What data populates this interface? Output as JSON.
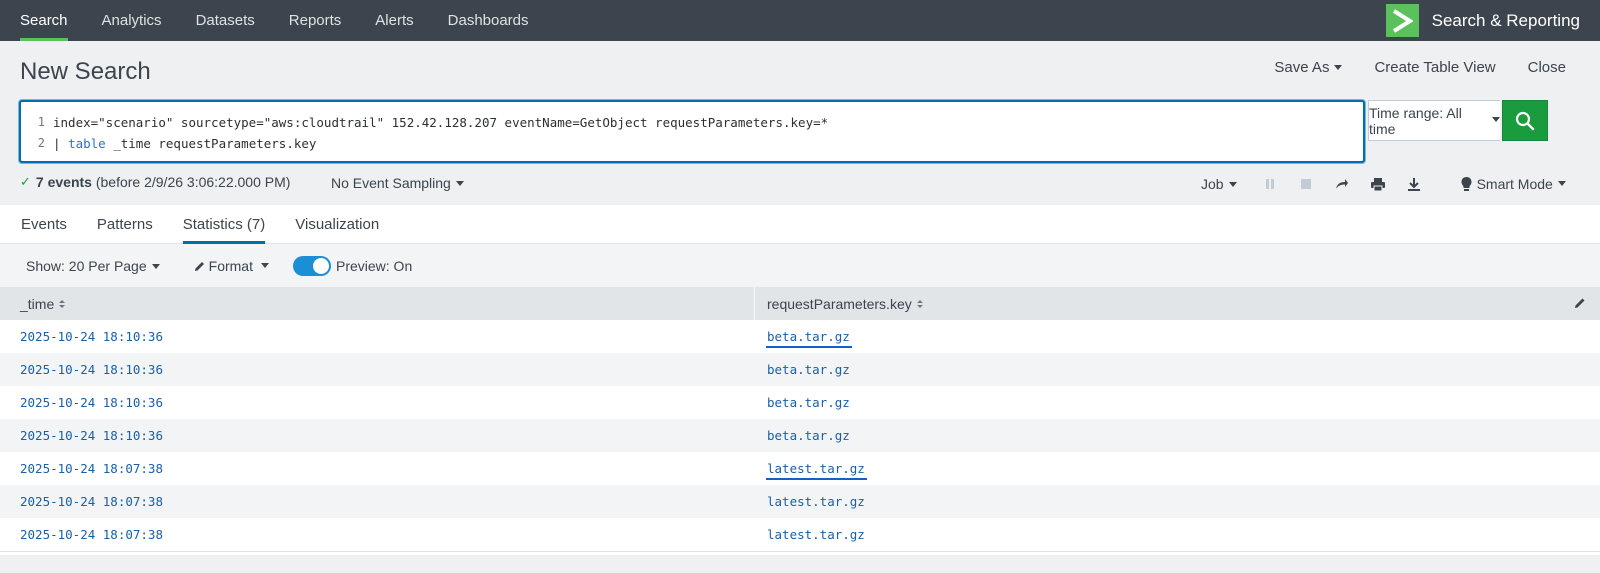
{
  "nav": {
    "items": [
      {
        "label": "Search",
        "active": true
      },
      {
        "label": "Analytics"
      },
      {
        "label": "Datasets"
      },
      {
        "label": "Reports"
      },
      {
        "label": "Alerts"
      },
      {
        "label": "Dashboards"
      }
    ],
    "app_title": "Search & Reporting"
  },
  "header": {
    "title": "New Search",
    "save_as": "Save As",
    "create_table_view": "Create Table View",
    "close": "Close"
  },
  "search": {
    "line_numbers": [
      "1",
      "2"
    ],
    "line1": "index=\"scenario\" sourcetype=\"aws:cloudtrail\" 152.42.128.207 eventName=GetObject requestParameters.key=*",
    "line2_pipe": "| ",
    "line2_keyword": "table",
    "line2_rest": " _time requestParameters.key",
    "time_range": "Time range: All time"
  },
  "status": {
    "events_count": "7 events",
    "events_detail": "(before 2/9/26 3:06:22.000 PM)",
    "sampling": "No Event Sampling",
    "job": "Job",
    "mode": "Smart Mode"
  },
  "tabs": [
    "Events",
    "Patterns",
    "Statistics (7)",
    "Visualization"
  ],
  "table_controls": {
    "show": "Show: 20 Per Page",
    "format": "Format",
    "preview": "Preview: On"
  },
  "table": {
    "columns": [
      "_time",
      "requestParameters.key"
    ],
    "rows": [
      [
        "2025-10-24 18:10:36",
        "beta.tar.gz"
      ],
      [
        "2025-10-24 18:10:36",
        "beta.tar.gz"
      ],
      [
        "2025-10-24 18:10:36",
        "beta.tar.gz"
      ],
      [
        "2025-10-24 18:10:36",
        "beta.tar.gz"
      ],
      [
        "2025-10-24 18:07:38",
        "latest.tar.gz"
      ],
      [
        "2025-10-24 18:07:38",
        "latest.tar.gz"
      ],
      [
        "2025-10-24 18:07:38",
        "latest.tar.gz"
      ]
    ]
  },
  "colors": {
    "nav_bg": "#3c444d",
    "accent_green": "#5cc05c",
    "search_border": "#006eaa",
    "go_button": "#1a9c3e",
    "link_blue": "#1a5fa8",
    "underline_annotation": "#1560c8"
  },
  "icons": [
    "app-logo-chevron-icon",
    "search-icon",
    "check-icon",
    "pause-icon",
    "stop-icon",
    "share-icon",
    "print-icon",
    "export-icon",
    "lightbulb-icon",
    "pencil-icon",
    "sort-icon",
    "edit-columns-icon"
  ]
}
